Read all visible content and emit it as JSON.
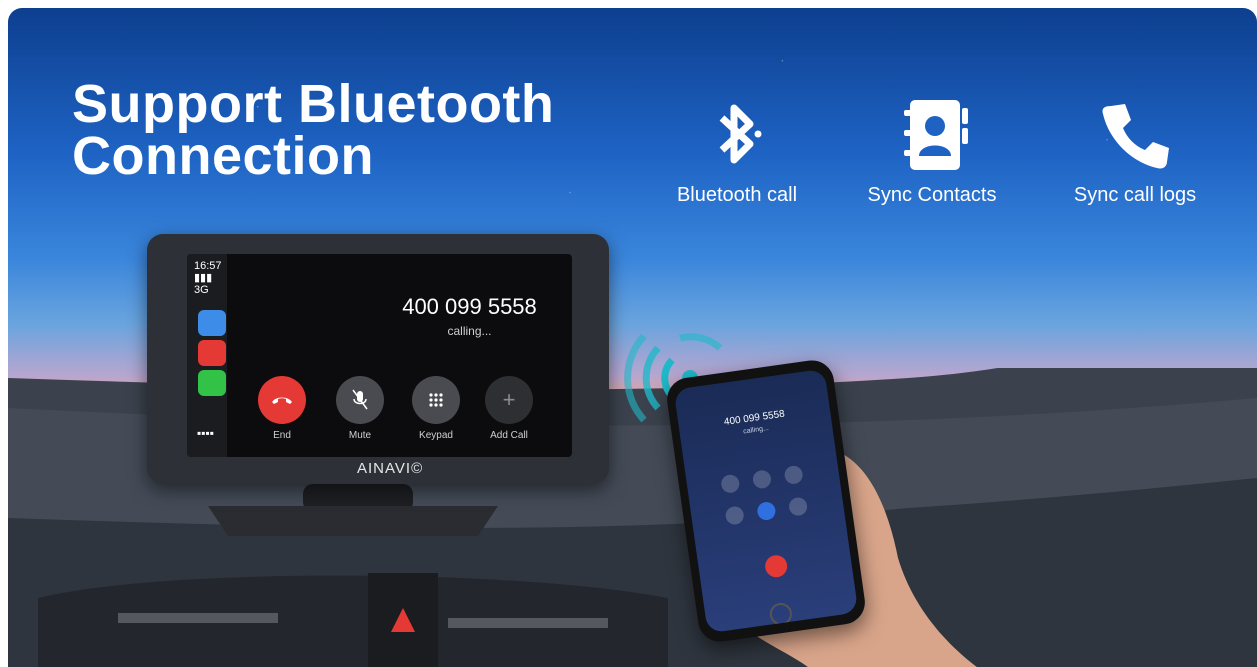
{
  "title": {
    "line1": "Support Bluetooth",
    "line2": "Connection"
  },
  "features": [
    {
      "label": "Bluetooth call",
      "icon": "bluetooth-icon"
    },
    {
      "label": "Sync  Contacts",
      "icon": "contacts-book-icon"
    },
    {
      "label": "Sync call logs",
      "icon": "phone-handset-icon"
    }
  ],
  "car_display": {
    "brand": "AINAVI©",
    "status_time": "16:57",
    "status_signal": "3G",
    "call_number": "400 099 5558",
    "call_status": "calling...",
    "buttons": [
      {
        "label": "End",
        "icon": "end-call-icon",
        "color": "#e53935"
      },
      {
        "label": "Mute",
        "icon": "microphone-mute-icon",
        "color": "#4a4b50"
      },
      {
        "label": "Keypad",
        "icon": "keypad-icon",
        "color": "#4a4b50"
      },
      {
        "label": "Add Call",
        "icon": "plus-icon",
        "color": "#2e2f33"
      }
    ]
  },
  "phone": {
    "call_number": "400 099 5558",
    "call_status": "calling..."
  },
  "colors": {
    "sky_top": "#0d3f8f",
    "sunset": "#f2b17e",
    "end_red": "#e53935",
    "accent_teal": "#20b8c8"
  }
}
